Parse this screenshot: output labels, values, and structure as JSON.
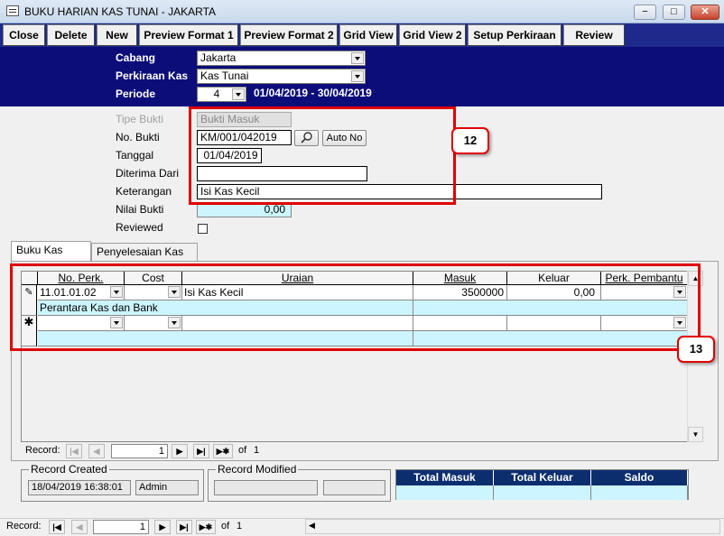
{
  "window": {
    "title": "BUKU HARIAN KAS TUNAI - JAKARTA",
    "min_glyph": "−",
    "max_glyph": "□",
    "close_glyph": "✕"
  },
  "toolbar": {
    "close": "Close",
    "delete": "Delete",
    "new": "New",
    "preview_format_1": "Preview Format 1",
    "preview_format_2": "Preview Format 2",
    "grid_view": "Grid View",
    "grid_view_2": "Grid View 2",
    "setup_perkiraan": "Setup Perkiraan",
    "review": "Review"
  },
  "header": {
    "cabang_label": "Cabang",
    "cabang_value": "Jakarta",
    "perkiraan_label": "Perkiraan Kas",
    "perkiraan_value": "Kas Tunai",
    "periode_label": "Periode",
    "periode_value": "4",
    "periode_range": "01/04/2019 - 30/04/2019"
  },
  "form": {
    "tipe_bukti_label": "Tipe Bukti",
    "tipe_bukti_value": "Bukti Masuk",
    "no_bukti_label": "No. Bukti",
    "no_bukti_value": "KM/001/042019",
    "search_icon": "magnifier-icon",
    "auto_no": "Auto No",
    "tanggal_label": "Tanggal",
    "tanggal_value": "01/04/2019",
    "diterima_label": "Diterima Dari",
    "diterima_value": "",
    "keterangan_label": "Keterangan",
    "keterangan_value": "Isi Kas Kecil",
    "nilai_label": "Nilai Bukti",
    "nilai_value": "0,00",
    "reviewed_label": "Reviewed",
    "reviewed_checked": false
  },
  "callouts": {
    "c12": "12",
    "c13": "13",
    "color": "#e00000"
  },
  "tabs": [
    "Buku Kas Detail",
    "Penyelesaian Kas Bon"
  ],
  "grid": {
    "columns": [
      "No. Perk.",
      "Cost Center",
      "Uraian",
      "Masuk",
      "Keluar",
      "Perk. Pembantu"
    ],
    "rows": [
      {
        "marker": "✎",
        "no_perk": "11.01.01.02",
        "cost_center": "",
        "uraian": "Isi Kas Kecil",
        "masuk": "3500000",
        "keluar": "0,00",
        "perk_pembantu": "",
        "sub": "Perantara Kas dan Bank"
      },
      {
        "marker": "✱",
        "no_perk": "",
        "cost_center": "",
        "uraian": "",
        "masuk": "",
        "keluar": "",
        "perk_pembantu": "",
        "sub": ""
      }
    ]
  },
  "inner_nav": {
    "record_label": "Record:",
    "current": "1",
    "of_label": "of",
    "total": "1"
  },
  "outer_nav": {
    "record_label": "Record:",
    "current": "1",
    "of_label": "of",
    "total": "1"
  },
  "record_created": {
    "label": "Record Created",
    "datetime": "18/04/2019 16:38:01",
    "user": "Admin"
  },
  "record_modified": {
    "label": "Record Modified",
    "datetime": "",
    "user": ""
  },
  "totals": {
    "headers": [
      "Total Masuk",
      "Total Keluar",
      "Saldo"
    ],
    "values": [
      "",
      "",
      ""
    ]
  },
  "colors": {
    "toolbar_bg": "#1d2a8b",
    "header_bg": "#0d0d7a",
    "cyan_field": "#ccf5ff",
    "totals_header": "#0d2e6e"
  }
}
